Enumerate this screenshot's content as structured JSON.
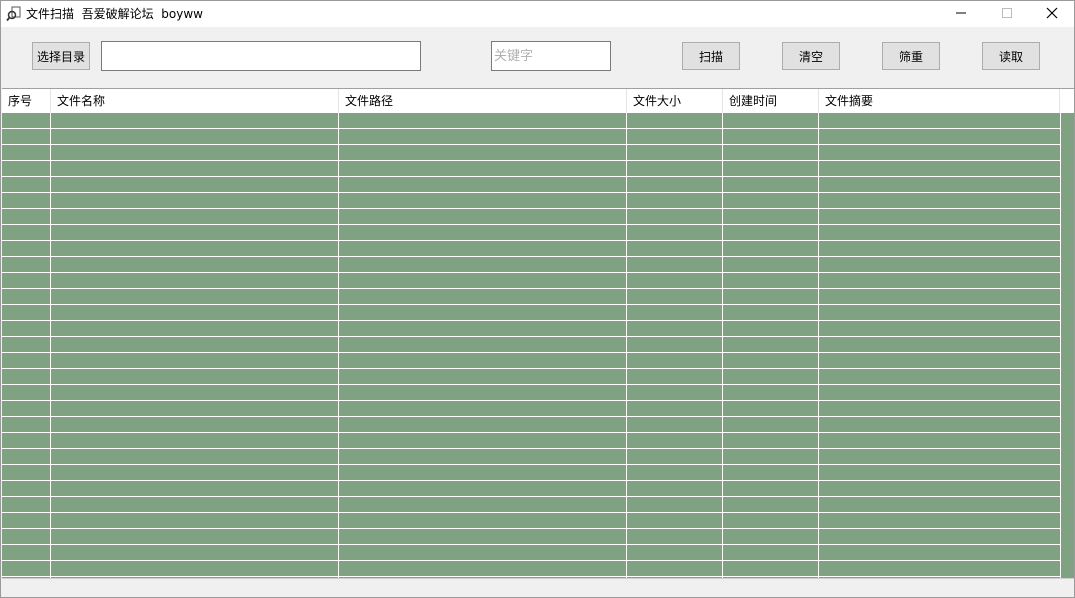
{
  "window": {
    "title": "文件扫描  吾爱破解论坛  boyww"
  },
  "toolbar": {
    "select_dir_label": "选择目录",
    "dir_path_value": "",
    "keyword_placeholder": "关键字",
    "scan_label": "扫描",
    "clear_label": "清空",
    "dedupe_label": "筛重",
    "read_label": "读取"
  },
  "grid": {
    "columns": [
      "序号",
      "文件名称",
      "文件路径",
      "文件大小",
      "创建时间",
      "文件摘要"
    ],
    "row_background": "#7fa283"
  },
  "icons": {
    "app": "magnifier-file-icon",
    "minimize": "minimize-icon",
    "maximize": "maximize-icon",
    "close": "close-icon"
  }
}
